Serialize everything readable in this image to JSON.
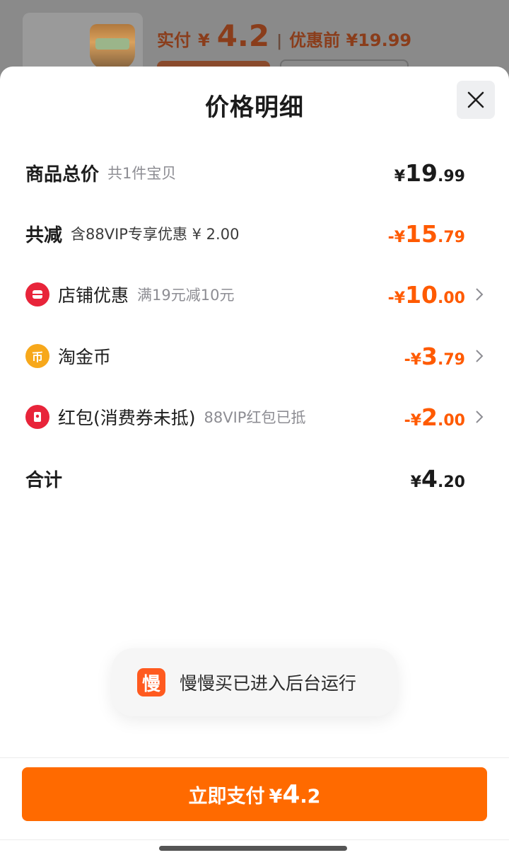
{
  "background_card": {
    "pay_label": "实付",
    "pay_currency": "¥",
    "pay_amount": "4.2",
    "separator": "|",
    "before_label": "优惠前 ¥19.99"
  },
  "sheet": {
    "title": "价格明细",
    "close_icon": "close-icon"
  },
  "rows": {
    "total_goods": {
      "label": "商品总价",
      "sub": "共1件宝贝",
      "currency": "¥",
      "int": "19",
      "dec": ".99"
    },
    "total_reduced": {
      "label": "共减",
      "sub": "含88VIP专享优惠 ¥ 2.00",
      "currency": "-¥",
      "int": "15",
      "dec": ".79"
    },
    "shop_discount": {
      "icon": "shop-coupon-icon",
      "icon_color": "#e8243a",
      "label": "店铺优惠",
      "sub": "满19元减10元",
      "currency": "-¥",
      "int": "10",
      "dec": ".00"
    },
    "taojinbi": {
      "icon": "coin-icon",
      "icon_color": "#f7a81b",
      "icon_glyph": "币",
      "label": "淘金币",
      "sub": "",
      "currency": "-¥",
      "int": "3",
      "dec": ".79"
    },
    "red_packet": {
      "icon": "red-packet-icon",
      "icon_color": "#e8243a",
      "label": "红包(消费券未抵)",
      "sub": "88VIP红包已抵",
      "currency": "-¥",
      "int": "2",
      "dec": ".00"
    },
    "sum": {
      "label": "合计",
      "currency": "¥",
      "int": "4",
      "dec": ".20"
    }
  },
  "toast": {
    "icon_glyph": "慢",
    "text": "慢慢买已进入后台运行"
  },
  "footer": {
    "pay_label": "立即支付",
    "currency": "¥",
    "int": "4",
    "dec": ".2"
  },
  "colors": {
    "accent": "#ff6a00",
    "discount_text": "#ff5a00"
  }
}
